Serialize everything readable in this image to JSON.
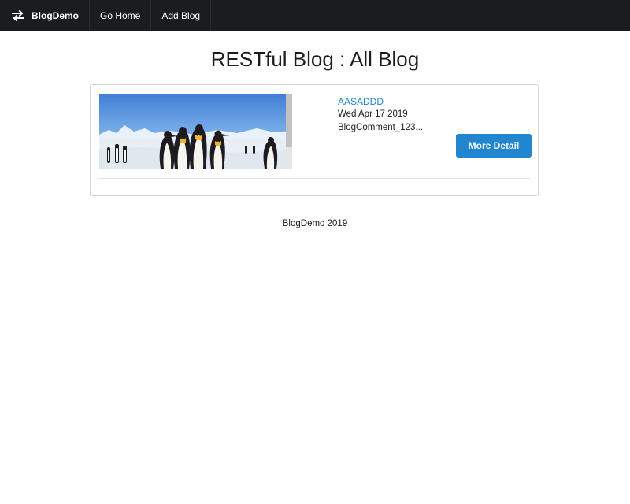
{
  "nav": {
    "brand_label": "BlogDemo",
    "brand_icon": "exchange-icon",
    "items": [
      {
        "label": "Go Home"
      },
      {
        "label": "Add Blog"
      }
    ]
  },
  "page": {
    "title": "RESTful Blog : All Blog"
  },
  "blogs": [
    {
      "title": "AASADDD",
      "date": "Wed Apr 17 2019",
      "excerpt": "BlogComment_123...",
      "button_label": "More Detail",
      "image": "penguins-on-snow"
    }
  ],
  "footer": {
    "text": "BlogDemo 2019"
  },
  "colors": {
    "navbar": "#1b1c1d",
    "primary": "#2185d0",
    "link": "#2185d0",
    "card_border": "#d4d4d5"
  }
}
